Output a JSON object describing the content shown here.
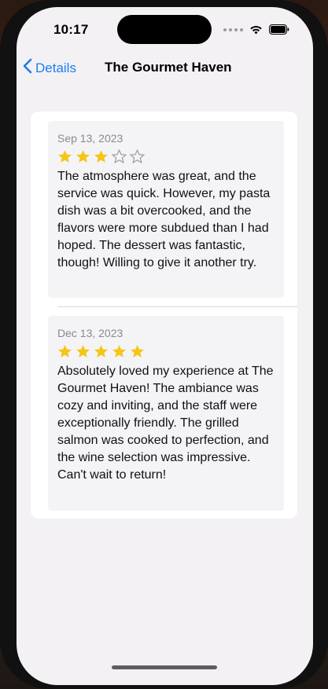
{
  "status_bar": {
    "time": "10:17"
  },
  "nav": {
    "back_label": "Details",
    "title": "The Gourmet Haven"
  },
  "colors": {
    "accent": "#1e7cf2",
    "star_filled": "#f5c518",
    "star_empty": "#9a9a9a"
  },
  "reviews": [
    {
      "date": "Sep 13, 2023",
      "rating": 3,
      "max_rating": 5,
      "text": "The atmosphere was great, and the service was quick. However, my pasta dish was a bit overcooked, and the flavors were more subdued than I had hoped. The dessert was fantastic, though! Willing to give it another try."
    },
    {
      "date": "Dec 13, 2023",
      "rating": 5,
      "max_rating": 5,
      "text": "Absolutely loved my experience at The Gourmet Haven! The ambiance was cozy and inviting, and the staff were exceptionally friendly. The grilled salmon was cooked to perfection, and the wine selection was impressive. Can't wait to return!"
    }
  ]
}
